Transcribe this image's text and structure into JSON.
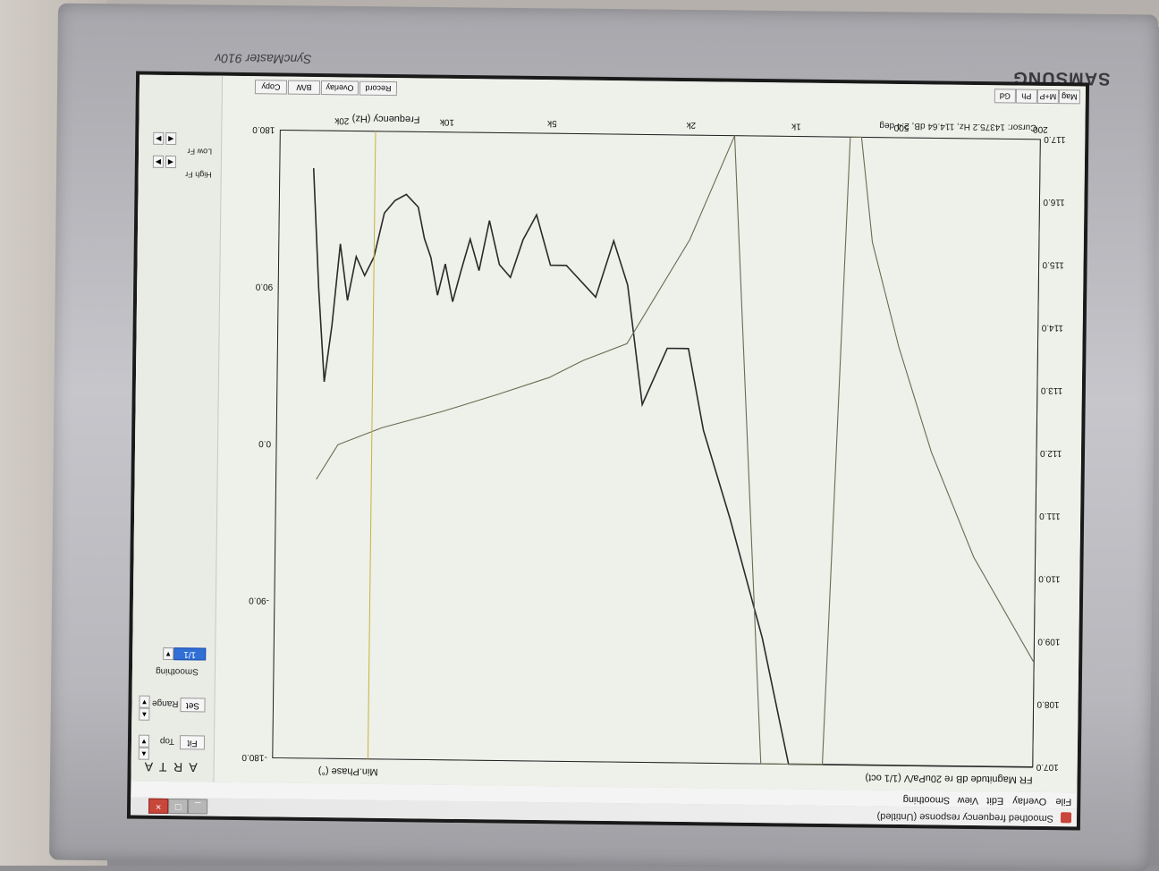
{
  "monitor": {
    "brand": "SAMSUNG",
    "model": "SyncMaster 910v"
  },
  "window": {
    "title": "Smoothed frequency response (Untitled)",
    "menu": [
      "File",
      "Overlay",
      "Edit",
      "View",
      "Smoothing"
    ]
  },
  "controls": {
    "top_label": "Top",
    "fit_label": "Fit",
    "range_label": "Range",
    "set_label": "Set",
    "smoothing_label": "Smoothing",
    "smoothing_value": "1/1",
    "app_logo": "A R T A"
  },
  "tabs_top": [
    "Mag",
    "M+P",
    "Ph",
    "Gd"
  ],
  "tabs_bottom": [
    "Record",
    "Overlay",
    "B/W",
    "Copy"
  ],
  "right_controls": {
    "high_label": "High Fr",
    "low_label": "Low Fr"
  },
  "cursor_readout": "Cursor: 14375.2 Hz, 114.64 dB, 2.4 deg",
  "chart_data": {
    "type": "line",
    "xlabel": "Frequency (Hz)",
    "ylabel_left": "FR Magnitude dB re 20uPa/V (1/1 oct)",
    "ylabel_right": "Min.Phase (°)",
    "x_tick_labels": [
      "200",
      "500",
      "1k",
      "2k",
      "5k",
      "10k",
      "20k"
    ],
    "x_ticks": [
      200,
      500,
      1000,
      2000,
      5000,
      10000,
      20000
    ],
    "xlim": [
      200,
      30000
    ],
    "x_scale": "log",
    "ylim_left": [
      107.0,
      117.0
    ],
    "y_ticks_left": [
      "107.0",
      "108.0",
      "109.0",
      "110.0",
      "111.0",
      "112.0",
      "113.0",
      "114.0",
      "115.0",
      "116.0",
      "117.0"
    ],
    "ylim_right": [
      -180,
      180
    ],
    "y_ticks_right": [
      "-180.0",
      "-90.0",
      "0.0",
      "90.0",
      "180.0"
    ],
    "grid": true,
    "series": [
      {
        "role": "magnitude",
        "color": "#2a2a2a",
        "x": [
          200,
          400,
          700,
          900,
          1000,
          1200,
          1500,
          1800,
          2000,
          2300,
          2700,
          3000,
          3300,
          3700,
          4000,
          4500,
          5000,
          5500,
          6000,
          6500,
          7000,
          7500,
          8000,
          8500,
          9000,
          9500,
          10000,
          10500,
          11000,
          11500,
          12000,
          13000,
          14000,
          15000,
          16000,
          17000,
          18000,
          19000,
          20000,
          21000,
          22000,
          23000,
          24000
        ],
        "values": [
          107.0,
          107.0,
          107.0,
          107.0,
          107.0,
          109.0,
          110.9,
          112.3,
          113.6,
          113.6,
          112.7,
          114.6,
          115.3,
          114.4,
          114.6,
          114.9,
          114.9,
          115.7,
          115.3,
          114.7,
          114.9,
          115.6,
          114.8,
          115.3,
          114.8,
          114.3,
          114.9,
          114.4,
          115.0,
          115.3,
          115.8,
          116.0,
          115.9,
          115.7,
          115.0,
          114.7,
          115.0,
          114.3,
          115.2,
          113.9,
          113.0,
          114.5,
          116.4
        ]
      },
      {
        "role": "phase",
        "color": "#6b6b52",
        "x": [
          200,
          300,
          400,
          500,
          600,
          650,
          700,
          800,
          1000,
          1200,
          1500,
          2000,
          3000,
          4000,
          5000,
          7000,
          10000,
          15000,
          20000,
          23000
        ],
        "values": [
          -120,
          -60,
          0,
          60,
          120,
          180,
          180,
          -180,
          -180,
          -180,
          180,
          120,
          60,
          50,
          40,
          30,
          20,
          10,
          0,
          -20
        ]
      },
      {
        "role": "reference",
        "color": "#c9b23a",
        "x": [
          16000
        ],
        "values": [
          117.0
        ]
      }
    ]
  }
}
